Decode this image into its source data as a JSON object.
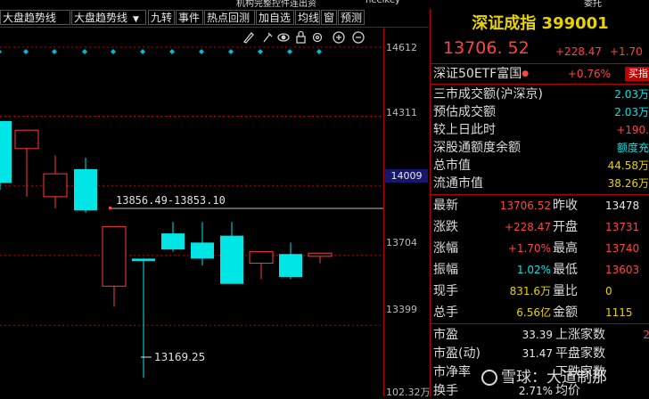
{
  "topstrip": {
    "items": [
      "机构完整控件连出资",
      "neelkey",
      "委托"
    ]
  },
  "toolbar": {
    "tabs": [
      {
        "label": "大盘趋势线",
        "dropdown": false
      },
      {
        "label": "大盘趋势线",
        "dropdown": true
      },
      {
        "label": "九转",
        "dropdown": false
      },
      {
        "label": "事件",
        "dropdown": false
      },
      {
        "label": "热点回测",
        "dropdown": false
      },
      {
        "label": "加自选",
        "dropdown": false
      },
      {
        "label": "均线",
        "dropdown": false
      },
      {
        "label": "窗",
        "dropdown": false
      },
      {
        "label": "预测",
        "dropdown": false
      }
    ],
    "tools": [
      "draw-icon",
      "pen-icon",
      "eye-icon",
      "lock-icon",
      "settings-icon",
      "zoom-in-icon",
      "zoom-out-icon"
    ]
  },
  "chart": {
    "y_ticks": [
      "14612",
      "14311",
      "14009",
      "13704",
      "13399",
      "102.32万"
    ],
    "current_price_tag": "14009",
    "gap_label": "13856.49-13853.10",
    "low_label": "13169.25",
    "colors": {
      "up": "#ff3b3b",
      "down": "#00e6e6",
      "gridline": "#c00000",
      "marker": "#00bcd4"
    }
  },
  "chart_data": {
    "type": "candlestick",
    "candles": [
      {
        "open": 14290,
        "close": 14020,
        "high": 14290,
        "low": 13990
      },
      {
        "open": 14170,
        "close": 14250,
        "high": 14250,
        "low": 13960
      },
      {
        "open": 13960,
        "close": 14060,
        "high": 14140,
        "low": 13910
      },
      {
        "open": 14080,
        "close": 13900,
        "high": 14130,
        "low": 13890
      },
      {
        "open": 13570,
        "close": 13830,
        "high": 13830,
        "low": 13480
      },
      {
        "open": 13690,
        "close": 13680,
        "high": 13690,
        "low": 13170
      },
      {
        "open": 13800,
        "close": 13730,
        "high": 13850,
        "low": 13720
      },
      {
        "open": 13760,
        "close": 13690,
        "high": 13850,
        "low": 13660
      },
      {
        "open": 13790,
        "close": 13580,
        "high": 13850,
        "low": 13580
      },
      {
        "open": 13670,
        "close": 13720,
        "high": 13720,
        "low": 13600
      },
      {
        "open": 13710,
        "close": 13610,
        "high": 13760,
        "low": 13600
      },
      {
        "open": 13700,
        "close": 13714,
        "high": 13714,
        "low": 13670
      }
    ],
    "ylim": [
      13105,
      14612
    ]
  },
  "panel": {
    "title": "深证成指 399001",
    "price": "13706. 52",
    "change": "+228.47",
    "change_pct": "+1.70",
    "etf_label": "深证50ETF富国",
    "etf_pct": "+0.76%",
    "buy_label": "买指",
    "stats": [
      {
        "label": "三市成交额(沪深京)",
        "value": "2.03万",
        "color": "cyan"
      },
      {
        "label": "预估成交额",
        "value": "2.03万",
        "color": "cyan"
      },
      {
        "label": "较上日此时",
        "value": "+190.",
        "color": "red"
      },
      {
        "label": "深股通额度余额",
        "value": "额度充",
        "color": "cyan"
      },
      {
        "label": "总市值",
        "value": "44.58万",
        "color": "yellow"
      },
      {
        "label": "流通市值",
        "value": "38.26万",
        "color": "yellow"
      }
    ],
    "quote": [
      {
        "l1": "最新",
        "v1": "13706.52",
        "c1": "red",
        "l2": "昨收",
        "v2": "13478",
        "c2": "white"
      },
      {
        "l1": "涨跌",
        "v1": "+228.47",
        "c1": "red",
        "l2": "开盘",
        "v2": "13731",
        "c2": "red"
      },
      {
        "l1": "涨幅",
        "v1": "+1.70%",
        "c1": "red",
        "l2": "最高",
        "v2": "13740",
        "c2": "red"
      },
      {
        "l1": "振幅",
        "v1": "1.02%",
        "c1": "cyan",
        "l2": "最低",
        "v2": "13603",
        "c2": "red"
      },
      {
        "l1": "现手",
        "v1": "831.6万",
        "c1": "yellow",
        "l2": "量比",
        "v2": "0",
        "c2": "yellow"
      },
      {
        "l1": "总手",
        "v1": "6.56亿",
        "c1": "yellow",
        "l2": "金额",
        "v2": "1115",
        "c2": "yellow"
      }
    ],
    "ratios": [
      {
        "l1": "市盈",
        "v1": "33.39",
        "l2": "上涨家数",
        "v2": "2"
      },
      {
        "l1": "市盈(动)",
        "v1": "31.47",
        "l2": "平盘家数",
        "v2": ""
      },
      {
        "l1": "市净率",
        "v1": "",
        "l2": "下跌家数",
        "v2": ""
      },
      {
        "l1": "换手",
        "v1": "2.71%",
        "l2": "均价",
        "v2": ""
      }
    ]
  },
  "watermark": "雪球：大道制那"
}
